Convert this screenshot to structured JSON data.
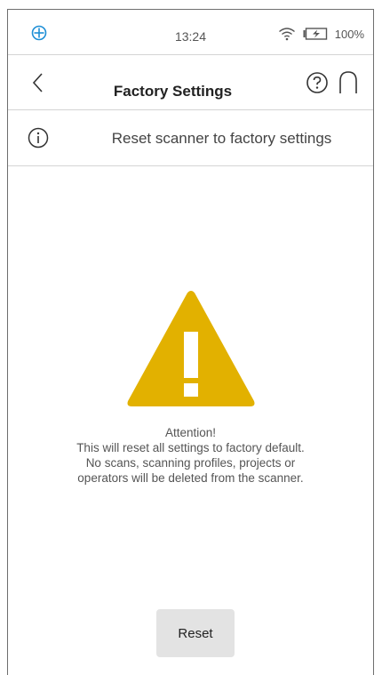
{
  "status_bar": {
    "time": "13:24",
    "battery_percent": "100%",
    "icons": [
      "app-logo-icon",
      "wifi-icon",
      "battery-charging-icon"
    ]
  },
  "header": {
    "title": "Factory Settings",
    "icons": [
      "back-chevron-icon",
      "help-icon",
      "home-icon"
    ]
  },
  "info_row": {
    "text": "Reset scanner to factory settings",
    "icon": "info-icon"
  },
  "warning": {
    "icon": "warning-triangle-icon",
    "color": "#e2b100",
    "lines": [
      "Attention!",
      "This will reset all settings to factory default.",
      "No scans, scanning profiles, projects or",
      "operators will be deleted from the scanner."
    ]
  },
  "reset_button": {
    "label": "Reset"
  },
  "colors": {
    "divider": "#d4d4d4",
    "button_bg": "#e3e3e3",
    "logo_blue": "#1e8fd6"
  }
}
